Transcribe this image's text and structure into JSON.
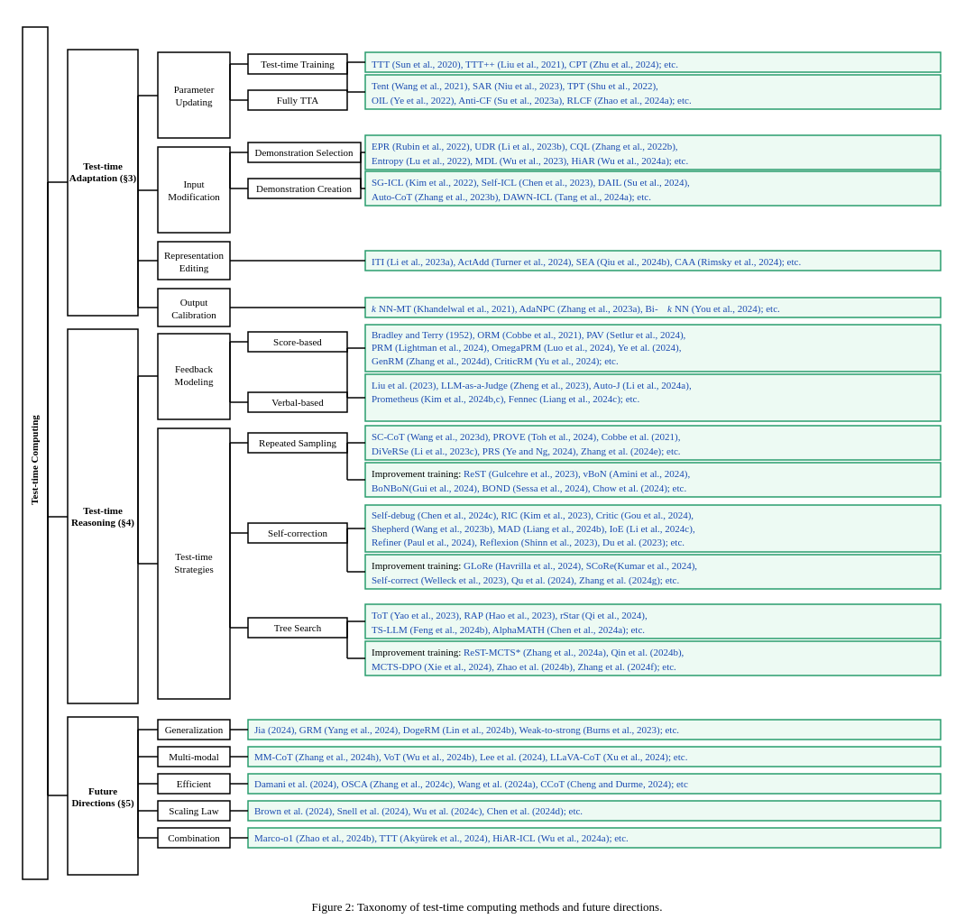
{
  "figure": {
    "caption": "Figure 2: Taxonomy of test-time computing methods and future directions.",
    "root": "Test-time Computing",
    "sections": {
      "adaptation": {
        "label": "Test-time\nAdaptation (§3)",
        "children": [
          {
            "label": "Parameter\nUpdating",
            "children": [
              {
                "label": "Test-time Training",
                "content": "TTT (Sun et al., 2020), TTT++ (Liu et al., 2021), CPT (Zhu et al., 2024); etc."
              },
              {
                "label": "Fully TTA",
                "content": "Tent (Wang et al., 2021), SAR (Niu et al., 2023), TPT (Shu et al., 2022),\nOIL (Ye et al., 2022), Anti-CF (Su et al., 2023a), RLCF (Zhao et al., 2024a); etc."
              }
            ]
          },
          {
            "label": "Input\nModification",
            "children": [
              {
                "label": "Demonstration Selection",
                "content": "EPR (Rubin et al., 2022), UDR (Li et al., 2023b), CQL (Zhang et al., 2022b),\nEntropy (Lu et al., 2022), MDL (Wu et al., 2023), HiAR (Wu et al., 2024a); etc."
              },
              {
                "label": "Demonstration Creation",
                "content": "SG-ICL (Kim et al., 2022), Self-ICL (Chen et al., 2023), DAIL (Su et al., 2024),\nAuto-CoT (Zhang et al., 2023b), DAWN-ICL (Tang et al., 2024a); etc."
              }
            ]
          },
          {
            "label": "Representation\nEditing",
            "content": "ITI (Li et al., 2023a), ActAdd (Turner et al., 2024), SEA (Qiu et al., 2024b), CAA (Rimsky et al., 2024); etc."
          },
          {
            "label": "Output\nCalibration",
            "content": "kNN-MT (Khandelwal et al., 2021), AdaNPC (Zhang et al., 2023a), Bi-kNN (You et al., 2024); etc.",
            "italic_prefix": "k"
          }
        ]
      },
      "reasoning": {
        "label": "Test-time\nReasoning (§4)",
        "children": [
          {
            "label": "Feedback\nModeling",
            "children": [
              {
                "label": "Score-based",
                "content": "Bradley and Terry (1952), ORM (Cobbe et al., 2021), PAV (Setlur et al., 2024),\nPRM (Lightman et al., 2024), OmegaPRM (Luo et al., 2024), Ye et al. (2024),\nGenRM (Zhang et al., 2024d), CriticRM (Yu et al., 2024); etc."
              },
              {
                "label": "Verbal-based",
                "content": "Liu et al. (2023), LLM-as-a-Judge (Zheng et al., 2023), Auto-J (Li et al., 2024a),\nPrometheus (Kim et al., 2024b,c), Fennec (Liang et al., 2024c); etc."
              }
            ]
          },
          {
            "label": "Test-time\nStrategies",
            "children": [
              {
                "label": "Repeated Sampling",
                "content_multi": [
                  "SC-CoT (Wang et al., 2023d), PROVE (Toh et al., 2024), Cobbe et al. (2021),\nDiVeRSe (Li et al., 2023c), PRS (Ye and Ng, 2024), Zhang et al. (2024e); etc.",
                  "Improvement training: ReST (Gulcehre et al., 2023), vBoN (Amini et al., 2024),\nBoNBoN(Gui et al., 2024), BOND (Sessa et al., 2024), Chow et al. (2024); etc."
                ]
              },
              {
                "label": "Self-correction",
                "content_multi": [
                  "Self-debug (Chen et al., 2024c), RIC (Kim et al., 2023), Critic (Gou et al., 2024),\nShepherd (Wang et al., 2023b), MAD (Liang et al., 2024b), IoE (Li et al., 2024c),\nRefiner (Paul et al., 2024), Reflexion (Shinn et al., 2023), Du et al. (2023); etc.",
                  "Improvement training: GLoRe (Havrilla et al., 2024), SCoRe(Kumar et al., 2024),\nSelf-correct (Welleck et al., 2023), Qu et al. (2024), Zhang et al. (2024g); etc."
                ]
              },
              {
                "label": "Tree Search",
                "content_multi": [
                  "ToT (Yao et al., 2023), RAP (Hao et al., 2023), rStar (Qi et al., 2024),\nTS-LLM (Feng et al., 2024b), AlphaMATH (Chen et al., 2024a); etc.",
                  "Improvement training: ReST-MCTS* (Zhang et al., 2024a), Qin et al. (2024b),\nMCTS-DPO (Xie et al., 2024), Zhao et al. (2024b), Zhang et al. (2024f); etc."
                ]
              }
            ]
          }
        ]
      },
      "future": {
        "label": "Future\nDirections (§5)",
        "children": [
          {
            "label": "Generalization",
            "content": "Jia (2024), GRM (Yang et al., 2024), DogeRM (Lin et al., 2024b), Weak-to-strong (Burns et al., 2023); etc."
          },
          {
            "label": "Multi-modal",
            "content": "MM-CoT (Zhang et al., 2024h), VoT (Wu et al., 2024b), Lee et al. (2024), LLaVA-CoT (Xu et al., 2024); etc."
          },
          {
            "label": "Efficient",
            "content": "Damani et al. (2024), OSCA (Zhang et al., 2024c), Wang et al. (2024a), CCoT (Cheng and Durme, 2024); etc"
          },
          {
            "label": "Scaling Law",
            "content": "Brown et al. (2024), Snell et al. (2024), Wu et al. (2024c), Chen et al. (2024d); etc."
          },
          {
            "label": "Combination",
            "content": "Marco-o1 (Zhao et al., 2024b), TTT (Akyürek et al., 2024), HiAR-ICL (Wu et al., 2024a); etc."
          }
        ]
      }
    }
  }
}
